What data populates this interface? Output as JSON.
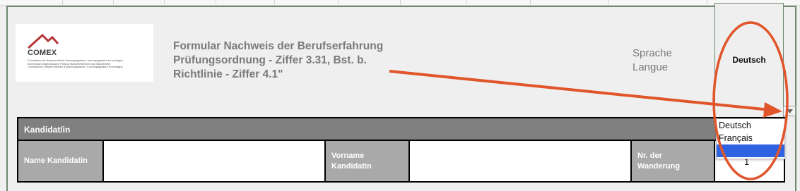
{
  "logo": {
    "name": "COMEX",
    "subtitle_lines": [
      "Commission de l'examen fédéral d'accompagnateur / accompagnatrice en montagne",
      "Kommission eidgenössische Prüfung Wanderleiterinnen und Wanderleiter",
      "Commissione d'esame federale d'accompagnatrice / d'accompagnatore di montagna"
    ]
  },
  "title": {
    "line1": "Formular Nachweis der Berufserfahrung",
    "line2": "Prüfungsordnung - Ziffer 3.31, Bst. b.",
    "line3": "Richtlinie - Ziffer 4.1\""
  },
  "language": {
    "label_de": "Sprache",
    "label_fr": "Langue",
    "value": "Deutsch"
  },
  "dropdown": {
    "options": [
      "Deutsch",
      "Français",
      ""
    ],
    "selected_index": 2
  },
  "table": {
    "header": "Kandidat/in",
    "name_label": "Name Kandidatin",
    "firstname_label_1": "Vorname",
    "firstname_label_2": "Kandidatin",
    "nr_label_1": "Nr. der",
    "nr_label_2": "Wanderung",
    "nr_value": "1"
  },
  "colors": {
    "annotation": "#e0552a",
    "header_bg": "#808080",
    "label_bg": "#a9a9a9",
    "selection": "#2f62e0"
  }
}
